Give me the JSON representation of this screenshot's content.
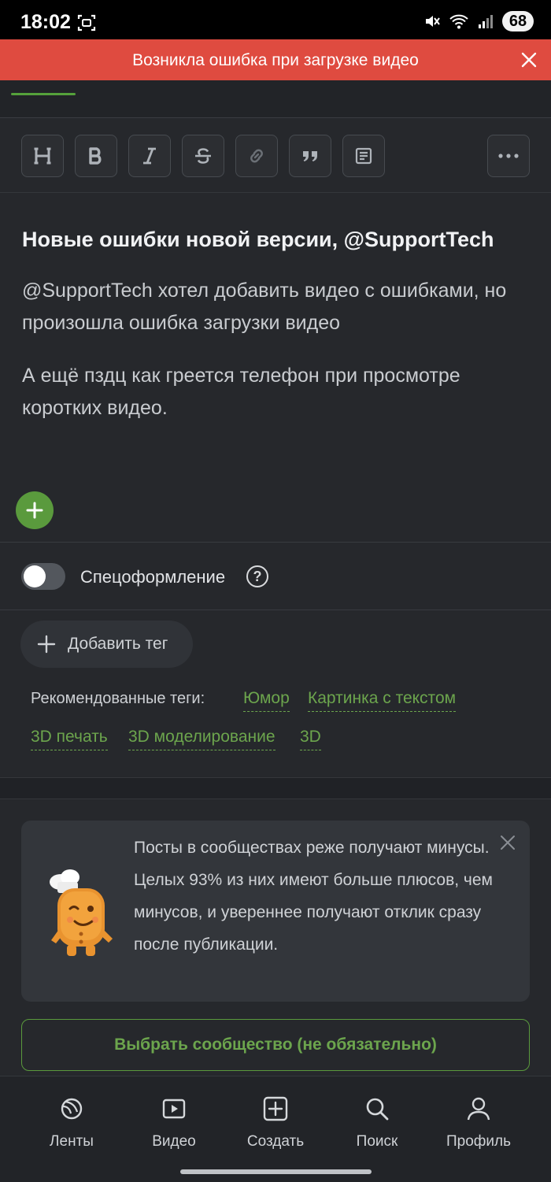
{
  "status_bar": {
    "time": "18:02",
    "battery": "68",
    "icons": [
      "screenshot-icon",
      "mute-icon",
      "wifi-icon",
      "signal-icon"
    ]
  },
  "error_banner": {
    "text": "Возникла ошибка при загрузке видео",
    "color": "#df4b40"
  },
  "toolbar": {
    "buttons": [
      {
        "name": "heading",
        "label": "H"
      },
      {
        "name": "bold",
        "label": "B"
      },
      {
        "name": "italic",
        "label": "I"
      },
      {
        "name": "strikethrough",
        "label": "S"
      },
      {
        "name": "link",
        "label": "link-icon"
      },
      {
        "name": "quote",
        "label": "quote-icon"
      },
      {
        "name": "note",
        "label": "note-icon"
      },
      {
        "name": "more",
        "label": "more-icon"
      }
    ]
  },
  "post": {
    "title": "Новые ошибки новой версии, @SupportTech",
    "paragraphs": [
      "@SupportTech хотел добавить видео с ошибками, но произошла ошибка загрузки видео",
      "А ещё пздц как греется телефон при просмотре коротких видео."
    ]
  },
  "special_format": {
    "label": "Спецоформление",
    "enabled": false,
    "help": "?"
  },
  "tags": {
    "add_label": "Добавить тег",
    "recommended_label": "Рекомендованные теги:",
    "recommended": [
      "Юмор",
      "Картинка с текстом",
      "3D печать",
      "3D моделирование",
      "3D"
    ]
  },
  "hint": {
    "text": "Посты в сообществах реже получают минусы. Целых 93% из них имеют больше плюсов, чем минусов, и увереннее получают отклик сразу после публикации."
  },
  "community_button": "Выбрать сообщество (не обязательно)",
  "bottom_nav": [
    {
      "label": "Ленты",
      "icon": "feeds-icon"
    },
    {
      "label": "Видео",
      "icon": "video-icon"
    },
    {
      "label": "Создать",
      "icon": "create-icon"
    },
    {
      "label": "Поиск",
      "icon": "search-icon"
    },
    {
      "label": "Профиль",
      "icon": "profile-icon"
    }
  ],
  "colors": {
    "accent": "#5a9a3d",
    "background": "#26282c"
  }
}
